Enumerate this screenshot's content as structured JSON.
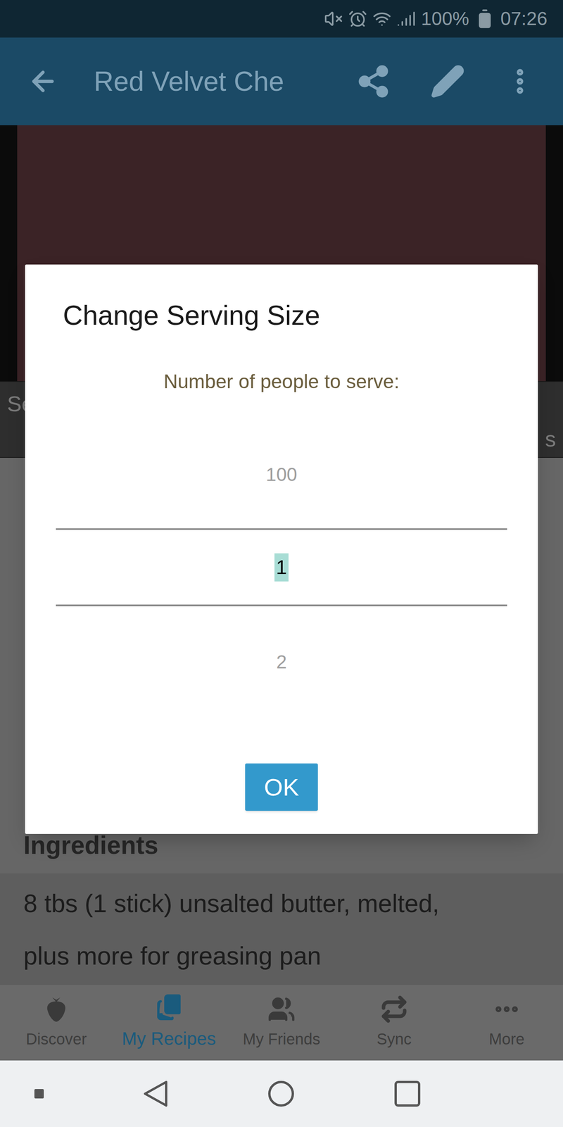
{
  "status_bar": {
    "battery": "100%",
    "time": "07:26"
  },
  "app_bar": {
    "title": "Red Velvet Che"
  },
  "strip": {
    "left": "Se",
    "right": "s"
  },
  "dialog": {
    "title": "Change Serving Size",
    "prompt": "Number of people to serve:",
    "picker": [
      {
        "value": "100",
        "selected": false
      },
      {
        "value": "1",
        "selected": true
      },
      {
        "value": "2",
        "selected": false
      }
    ],
    "buttons": [
      "OK"
    ]
  },
  "section": {
    "heading": "Ingredients",
    "lines": [
      "8 tbs (1 stick) unsalted butter, melted,",
      "plus more for greasing pan"
    ]
  },
  "bottom_nav": [
    {
      "label": "Discover",
      "selected": false
    },
    {
      "label": "My Recipes",
      "selected": true
    },
    {
      "label": "My Friends",
      "selected": false
    },
    {
      "label": "Sync",
      "selected": false
    },
    {
      "label": "More",
      "selected": false
    }
  ]
}
